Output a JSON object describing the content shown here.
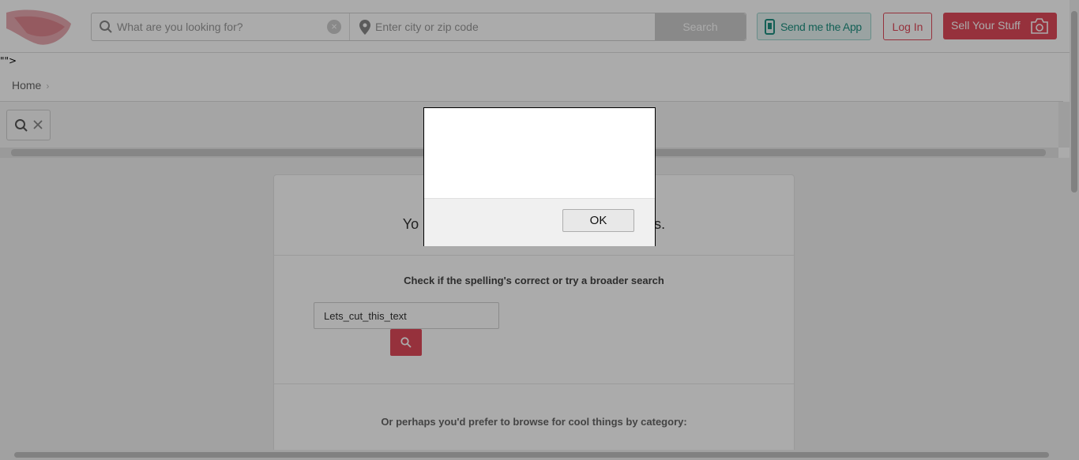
{
  "header": {
    "search_placeholder": "What are you looking for?",
    "location_placeholder": "Enter city or zip code",
    "search_button": "Search",
    "send_app": "Send me the App",
    "login": "Log In",
    "sell": "Sell Your Stuff"
  },
  "stray_text": "\"\">",
  "breadcrumb": {
    "home": "Home",
    "separator": "›"
  },
  "content": {
    "no_results_start": "Yo",
    "no_results_end": "s.",
    "check_text": "Check if the spelling's correct or try a broader search",
    "query_value": "Lets_cut_this_text",
    "browse_text": "Or perhaps you'd prefer to browse for cool things by category:"
  },
  "dialog": {
    "ok_label": "OK"
  },
  "colors": {
    "brand_red": "#e04a5a",
    "teal": "#1e9080"
  }
}
